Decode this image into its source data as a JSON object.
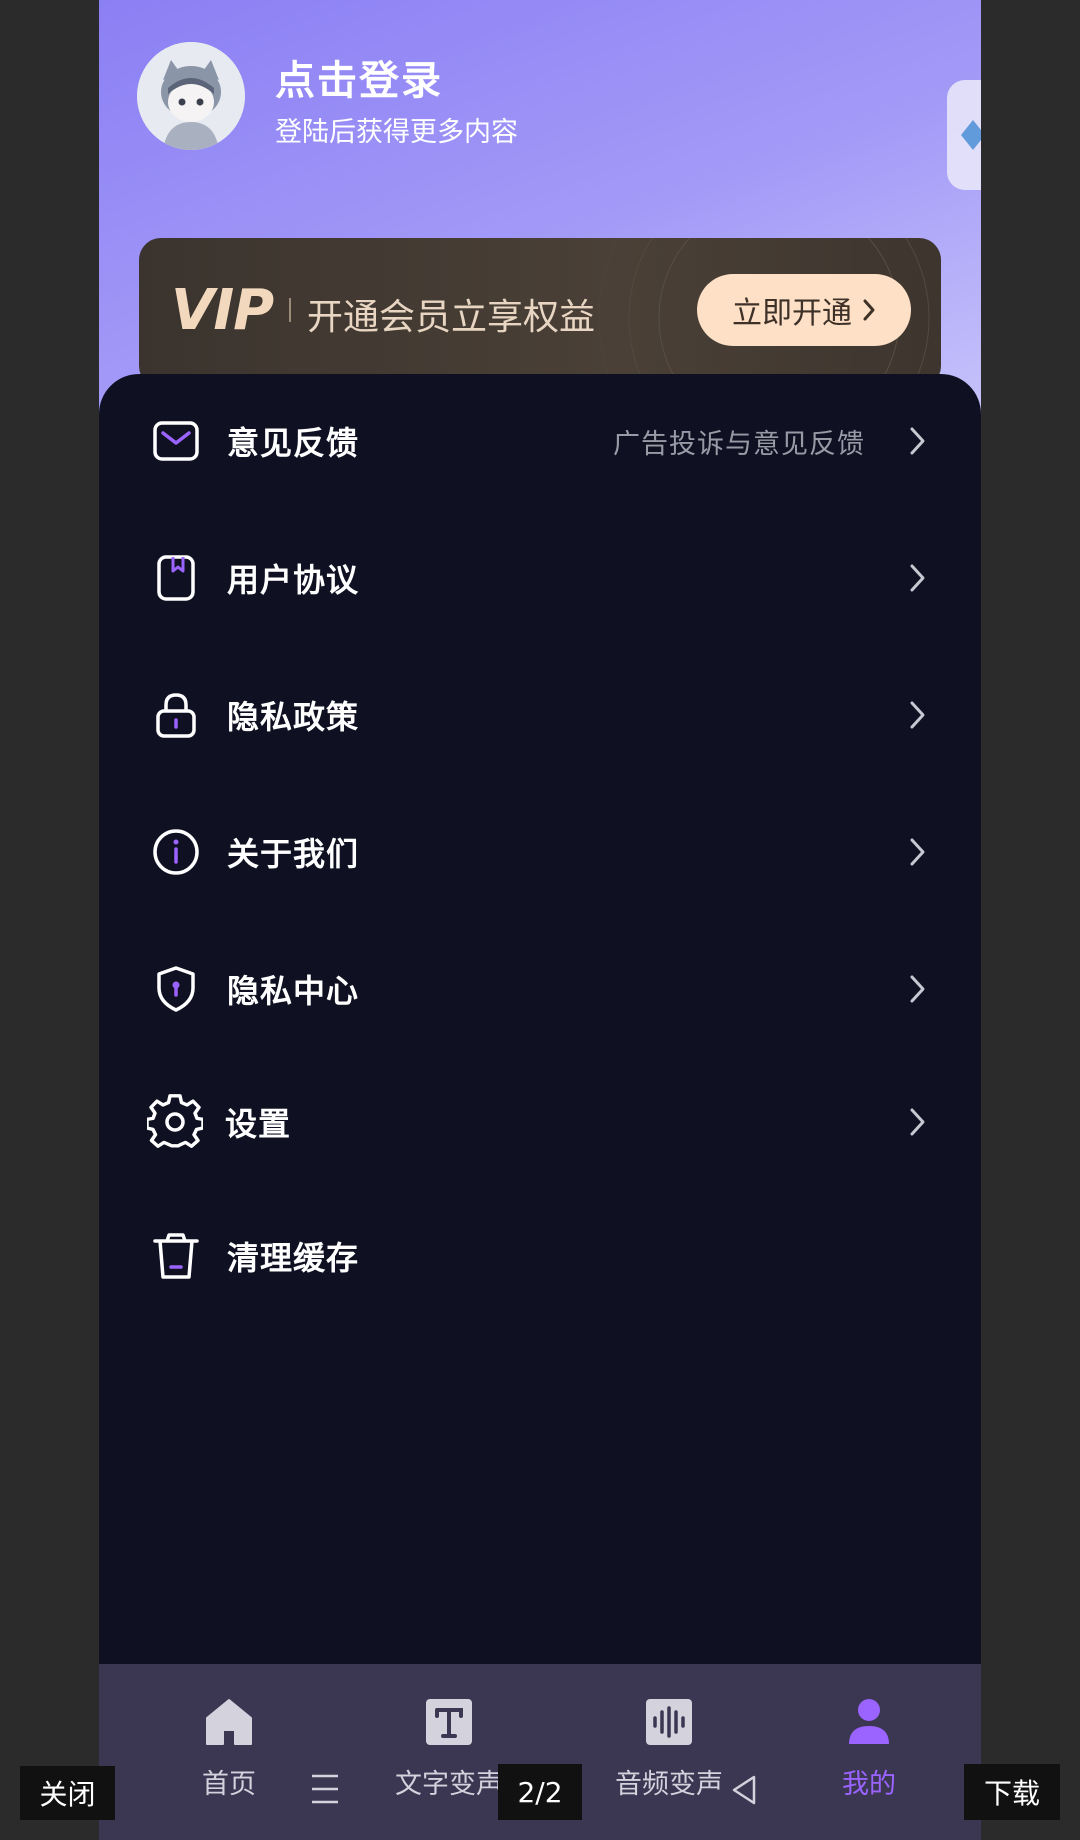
{
  "header": {
    "login_title": "点击登录",
    "login_subtitle": "登陆后获得更多内容"
  },
  "vip": {
    "logo": "VIP",
    "text": "开通会员立享权益",
    "button_label": "立即开通"
  },
  "menu": {
    "items": [
      {
        "label": "意见反馈",
        "hint": "广告投诉与意见反馈",
        "icon": "mail-icon"
      },
      {
        "label": "用户协议",
        "hint": "",
        "icon": "document-icon"
      },
      {
        "label": "隐私政策",
        "hint": "",
        "icon": "lock-icon"
      },
      {
        "label": "关于我们",
        "hint": "",
        "icon": "info-icon"
      },
      {
        "label": "隐私中心",
        "hint": "",
        "icon": "shield-icon"
      },
      {
        "label": "设置",
        "hint": "",
        "icon": "gear-icon"
      },
      {
        "label": "清理缓存",
        "hint": "",
        "icon": "trash-icon"
      }
    ]
  },
  "bottom_nav": {
    "items": [
      {
        "label": "首页",
        "icon": "home-icon",
        "active": false
      },
      {
        "label": "文字变声",
        "icon": "text-icon",
        "active": false
      },
      {
        "label": "音频变声",
        "icon": "waveform-icon",
        "active": false
      },
      {
        "label": "我的",
        "icon": "user-icon",
        "active": true
      }
    ]
  },
  "overlay": {
    "close_label": "关闭",
    "page_indicator": "2/2",
    "download_label": "下载"
  },
  "colors": {
    "accent": "#9b63ff",
    "background": "#0f1122",
    "vip_button": "#fde0c6"
  }
}
